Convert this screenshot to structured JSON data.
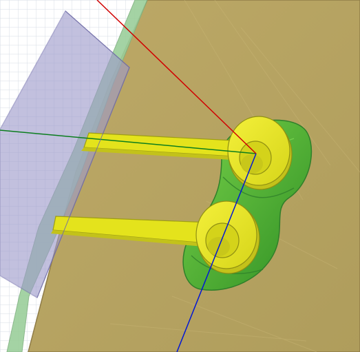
{
  "viewport": {
    "title": "",
    "colors": {
      "background": "#ffffff",
      "grid_line": "#d7dce6",
      "board": "#b6a460",
      "board_edge": "#8f7c47",
      "board_side": "#9bcf9b",
      "plane": "#9e9acb",
      "plane_edge": "#7c78b3",
      "copper_top": "#e4e31c",
      "copper_side": "#c3c21a",
      "dielectric": "#4db13d",
      "dielectric_dark": "#2f7f2a",
      "axis_x": "#d10000",
      "axis_y": "#0a7d1d",
      "axis_z": "#0016d6"
    },
    "icons": [
      "workplane-grid-icon",
      "substrate-board-icon",
      "port-plane-icon",
      "microstrip-feedline-icon",
      "ring-pad-icon",
      "x-axis-icon",
      "y-axis-icon",
      "z-axis-icon"
    ]
  }
}
